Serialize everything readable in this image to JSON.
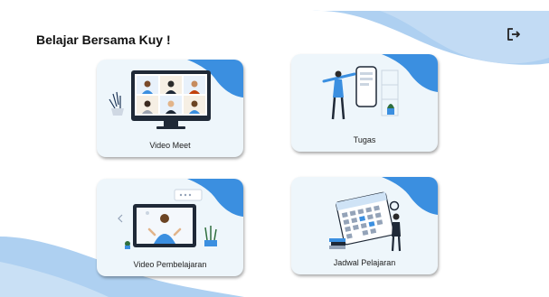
{
  "page": {
    "title": "Belajar Bersama Kuy !"
  },
  "header": {
    "logout_icon": "logout-icon"
  },
  "colors": {
    "accent": "#3b8fe0",
    "wave_light": "#aed0f1",
    "card_bg": "#eef6fb"
  },
  "menu": [
    {
      "label": "Video Meet",
      "icon": "video-meet-illustration"
    },
    {
      "label": "Tugas",
      "icon": "tugas-illustration"
    },
    {
      "label": "Video Pembelajaran",
      "icon": "video-pembelajaran-illustration"
    },
    {
      "label": "Jadwal Pelajaran",
      "icon": "jadwal-pelajaran-illustration"
    }
  ]
}
